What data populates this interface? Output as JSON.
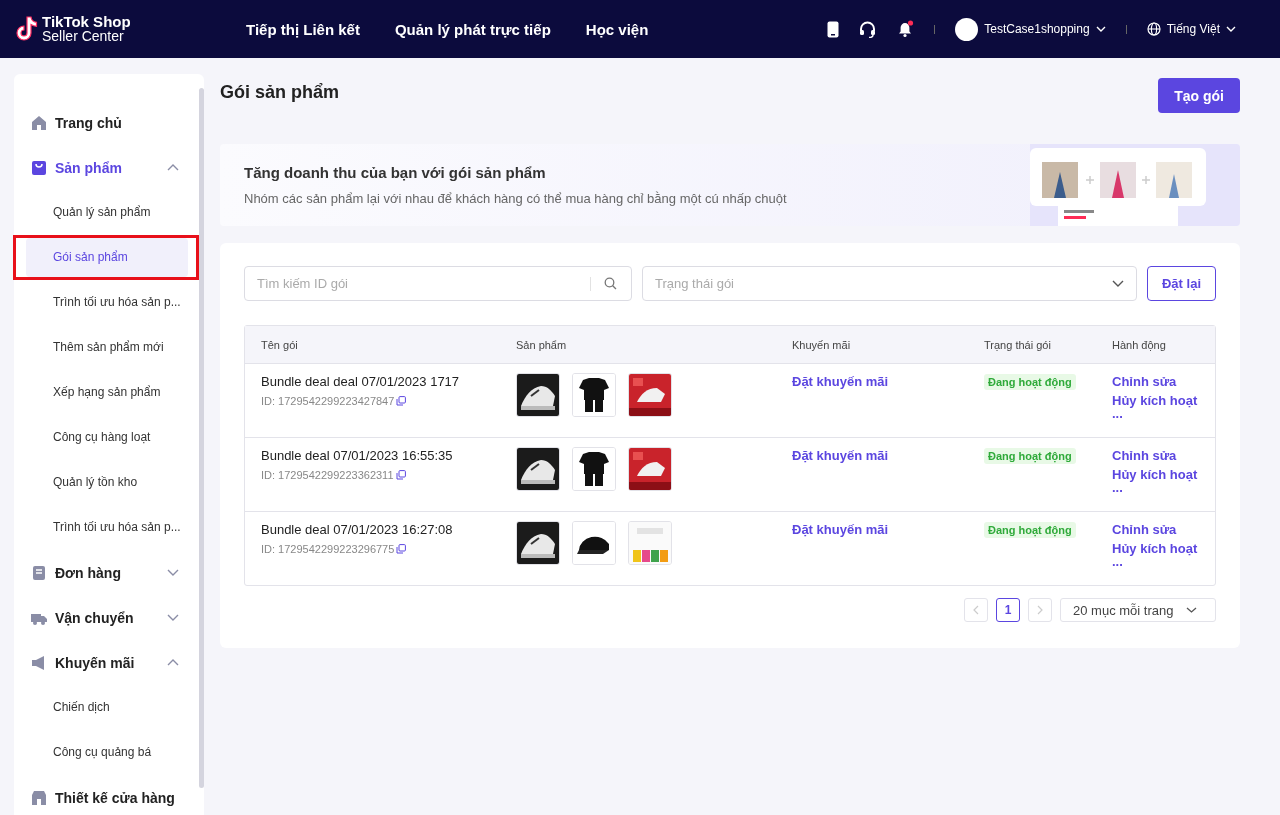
{
  "header": {
    "logo_line_1": "TikTok Shop",
    "logo_line_2": "Seller Center",
    "nav": [
      "Tiếp thị Liên kết",
      "Quản lý phát trực tiếp",
      "Học viện"
    ],
    "notification_unread": true,
    "account": "TestCase1shopping",
    "language": "Tiếng Việt"
  },
  "sidebar": {
    "items": [
      {
        "label": "Trang chủ",
        "selected": false
      },
      {
        "label": "Sản phẩm",
        "selected": true,
        "expanded": true,
        "children": [
          {
            "label": "Quản lý sản phẩm",
            "selected": false,
            "highlighted": false
          },
          {
            "label": "Gói sản phẩm",
            "selected": true,
            "highlighted": true
          },
          {
            "label": "Trình tối ưu hóa sản p...",
            "selected": false,
            "highlighted": false
          },
          {
            "label": "Thêm sản phẩm mới",
            "selected": false,
            "highlighted": false
          },
          {
            "label": "Xếp hạng sản phẩm",
            "selected": false,
            "highlighted": false
          },
          {
            "label": "Công cụ hàng loạt",
            "selected": false,
            "highlighted": false
          },
          {
            "label": "Quản lý tồn kho",
            "selected": false,
            "highlighted": false
          },
          {
            "label": "Trình tối ưu hóa sản p...",
            "selected": false,
            "highlighted": false
          }
        ]
      },
      {
        "label": "Đơn hàng",
        "selected": false,
        "expanded": false
      },
      {
        "label": "Vận chuyển",
        "selected": false,
        "expanded": false
      },
      {
        "label": "Khuyến mãi",
        "selected": false,
        "expanded": true,
        "children": [
          {
            "label": "Chiến dịch",
            "selected": false,
            "highlighted": false
          },
          {
            "label": "Công cụ quảng bá",
            "selected": false,
            "highlighted": false
          }
        ]
      },
      {
        "label": "Thiết kế cửa hàng",
        "selected": false
      }
    ]
  },
  "page": {
    "title": "Gói sản phẩm",
    "create_button": "Tạo gói"
  },
  "banner": {
    "title": "Tăng doanh thu của bạn với gói sản phẩm",
    "text": "Nhóm các sản phẩm lại với nhau để khách hàng có thể mua hàng chỉ bằng một cú nhấp chuột"
  },
  "filters": {
    "search": {
      "placeholder": "Tìm kiếm ID gói"
    },
    "status": {
      "placeholder": "Trạng thái gói"
    },
    "reset_button": "Đặt lại"
  },
  "table": {
    "columns": [
      "Tên gói",
      "Sản phẩm",
      "Khuyến mãi",
      "Trạng thái gói",
      "Hành động"
    ],
    "rows": [
      {
        "name": "Bundle deal deal 07/01/2023 1717",
        "id": "ID: 1729542299223427847",
        "promotion": "Đặt khuyến mãi",
        "status": "Đang hoạt động",
        "actions": [
          "Chỉnh sửa",
          "Hủy kích hoạt",
          "..."
        ]
      },
      {
        "name": "Bundle deal 07/01/2023 16:55:35",
        "id": "ID: 1729542299223362311",
        "promotion": "Đặt khuyến mãi",
        "status": "Đang hoạt động",
        "actions": [
          "Chỉnh sửa",
          "Hủy kích hoạt",
          "..."
        ]
      },
      {
        "name": "Bundle deal 07/01/2023 16:27:08",
        "id": "ID: 1729542299223296775",
        "promotion": "Đặt khuyến mãi",
        "status": "Đang hoạt động",
        "actions": [
          "Chỉnh sửa",
          "Hủy kích hoạt",
          "..."
        ]
      }
    ]
  },
  "pagination": {
    "pages": [
      {
        "label": "1",
        "selected": true
      }
    ],
    "page_size": "20 mục mỗi trang"
  }
}
